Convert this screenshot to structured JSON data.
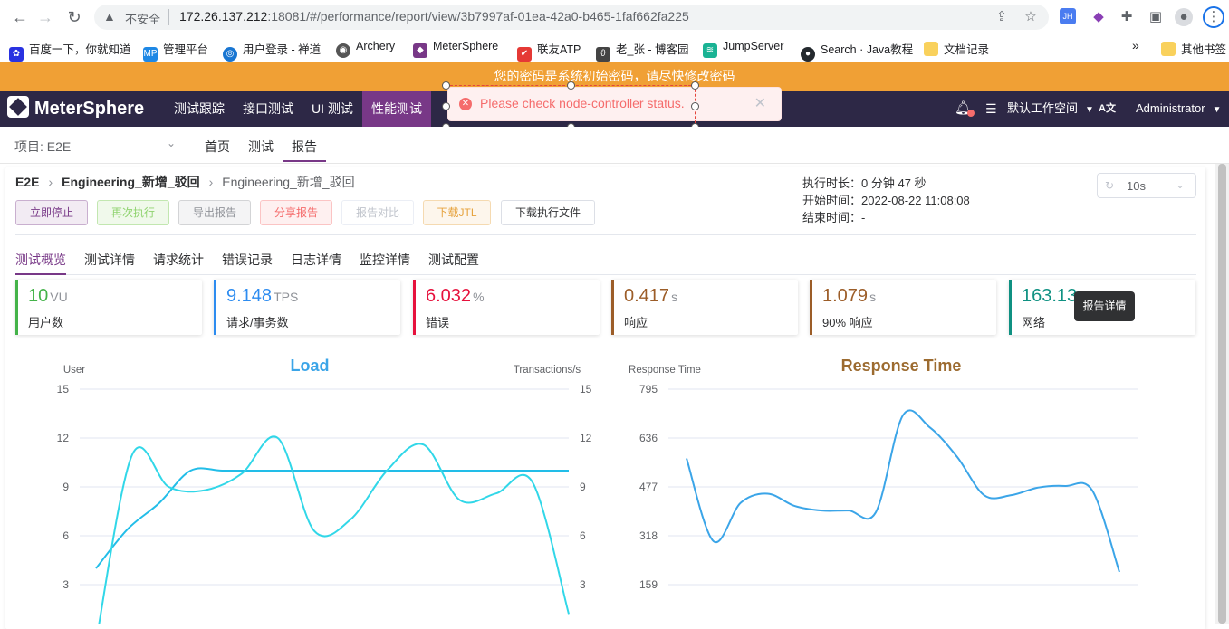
{
  "browser": {
    "insecure_label": "不安全",
    "url_host": "172.26.137.212",
    "url_rest": ":18081/#/performance/report/view/3b7997af-01ea-42a0-b465-1faf662fa225",
    "bookmarks": [
      {
        "label": "百度一下，你就知道",
        "icon": "baidu-paw-icon"
      },
      {
        "label": "管理平台",
        "icon": "mp-icon"
      },
      {
        "label": "用户登录 - 禅道",
        "icon": "zentao-icon"
      },
      {
        "label": "Archery",
        "icon": "archery-icon"
      },
      {
        "label": "MeterSphere",
        "icon": "metersphere-cube-icon"
      },
      {
        "label": "联友ATP",
        "icon": "atp-icon"
      },
      {
        "label": "老_张 - 博客园",
        "icon": "cnblogs-icon"
      },
      {
        "label": "JumpServer",
        "icon": "jumpserver-icon"
      },
      {
        "label": "Search · Java教程",
        "icon": "github-icon"
      },
      {
        "label": "文档记录",
        "icon": "folder-icon"
      }
    ],
    "more_bookmarks": "»",
    "other_bookmarks": "其他书签"
  },
  "banner": {
    "text": "您的密码是系统初始密码，请尽快修改密码"
  },
  "topnav": {
    "logo": "MeterSphere",
    "items": [
      "测试跟踪",
      "接口测试",
      "UI 测试",
      "性能测试"
    ],
    "workspace": "默认工作空间",
    "lang_icon": "A文",
    "user": "Administrator"
  },
  "toast": {
    "message": "Please check node-controller status."
  },
  "subnav": {
    "project": "项目: E2E",
    "tabs": [
      "首页",
      "测试",
      "报告"
    ]
  },
  "report": {
    "breadcrumb": [
      "E2E",
      "Engineering_新增_驳回",
      "Engineering_新增_驳回"
    ],
    "buttons": [
      "立即停止",
      "再次执行",
      "导出报告",
      "分享报告",
      "报告对比",
      "下载JTL",
      "下载执行文件"
    ],
    "exec": {
      "duration_label": "执行时长：",
      "duration": "0 分钟 47 秒",
      "start_label": "开始时间：",
      "start": "2022-08-22 11:08:08",
      "end_label": "结束时间：",
      "end": "-"
    },
    "refresh": "10s",
    "tabs": [
      "测试概览",
      "测试详情",
      "请求统计",
      "错误记录",
      "日志详情",
      "监控详情",
      "测试配置"
    ],
    "kpis": [
      {
        "value": "10",
        "unit": "VU",
        "label": "用户数",
        "color": "#44b349"
      },
      {
        "value": "9.148",
        "unit": "TPS",
        "label": "请求/事务数",
        "color": "#2d8cf0"
      },
      {
        "value": "6.032",
        "unit": "%",
        "label": "错误",
        "color": "#e6113c"
      },
      {
        "value": "0.417",
        "unit": "s",
        "label": "响应",
        "color": "#9c5d28"
      },
      {
        "value": "1.079",
        "unit": "s",
        "label": "90% 响应",
        "color": "#9c5d28"
      },
      {
        "value": "163.13",
        "unit": "",
        "label": "网络",
        "color": "#0f9182"
      }
    ],
    "tooltip": "报告详情"
  },
  "chart_data": [
    {
      "type": "line",
      "title": "Load",
      "ylabel": "User",
      "y2label": "Transactions/s",
      "ylim": [
        0,
        15
      ],
      "yticks": [
        "15",
        "12",
        "9",
        "6",
        "3"
      ],
      "series": [
        {
          "values": [
            4.0,
            6.4,
            8.0,
            10.0,
            10.0,
            10.0,
            10.0,
            10.0,
            10.0,
            10.0,
            10.0,
            10.0,
            10.0,
            10.0,
            10.0,
            10.0
          ],
          "axis": "left"
        },
        {
          "values": [
            -0.5,
            11.0,
            9.0,
            8.8,
            9.8,
            12.0,
            6.3,
            7.0,
            10.0,
            11.6,
            8.2,
            8.6,
            9.3,
            1.2
          ],
          "axis": "right"
        }
      ],
      "colors": [
        "#22bde8",
        "#31d7e8"
      ]
    },
    {
      "type": "line",
      "title": "Response Time",
      "ylabel": "Response Time",
      "ylim": [
        0,
        795
      ],
      "yticks": [
        "795",
        "636",
        "477",
        "318",
        "159"
      ],
      "series": [
        {
          "values": [
            570,
            300,
            425,
            455,
            415,
            400,
            400,
            395,
            710,
            670,
            575,
            450,
            450,
            475,
            480,
            465,
            200
          ]
        }
      ],
      "colors": [
        "#3ba5e8"
      ]
    }
  ]
}
